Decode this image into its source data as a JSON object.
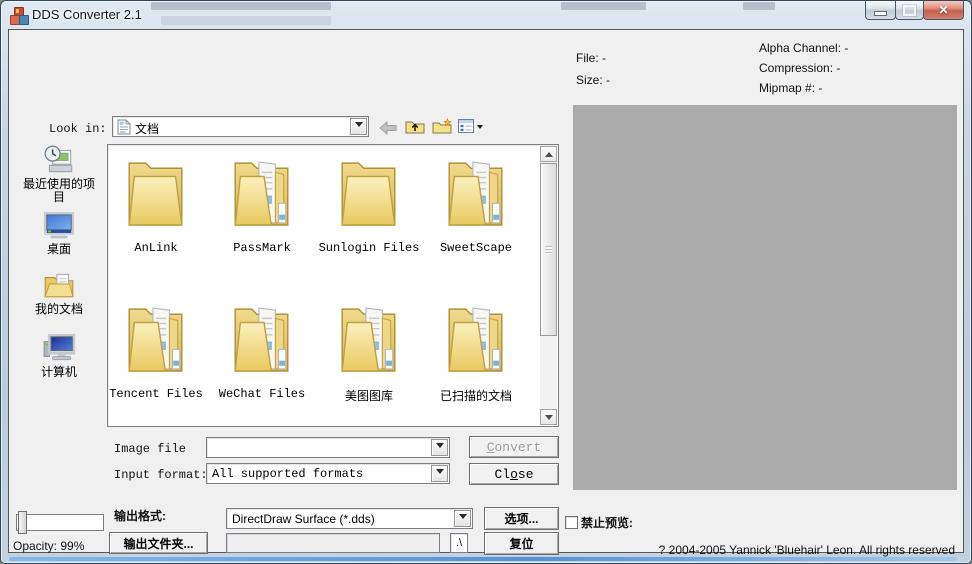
{
  "window": {
    "title": "DDS Converter 2.1"
  },
  "icons": {
    "close_glyph": "✕",
    "dropdown_glyph": "▼",
    "current_dir_glyph": ".\\"
  },
  "colors": {
    "preview_bg": "#ABABAB",
    "folder_yellow": "#EFD783",
    "close_button_red": "#C4604F",
    "titlebar_glass": "#C9D6E3",
    "client_bg": "#F0F0F0"
  },
  "info_panel": {
    "file_label": "File: -",
    "size_label": "Size: -",
    "alpha_label": "Alpha Channel: -",
    "compression_label": "Compression: -",
    "mipmap_label": "Mipmap #: -"
  },
  "file_dialog": {
    "look_in_label": "Look in:",
    "look_in_value": "文档",
    "places": [
      {
        "label": "最近使用的项目"
      },
      {
        "label": "桌面"
      },
      {
        "label": "我的文档"
      },
      {
        "label": "计算机"
      }
    ],
    "folders": [
      {
        "name": "AnLink",
        "icon": "#folder-empty"
      },
      {
        "name": "PassMark",
        "icon": "#folder-full"
      },
      {
        "name": "Sunlogin Files",
        "icon": "#folder-empty"
      },
      {
        "name": "SweetScape",
        "icon": "#folder-full"
      },
      {
        "name": "Tencent Files",
        "icon": "#folder-full"
      },
      {
        "name": "WeChat Files",
        "icon": "#folder-full"
      },
      {
        "name": "美图图库",
        "icon": "#folder-full"
      },
      {
        "name": "已扫描的文档",
        "icon": "#folder-full"
      }
    ]
  },
  "form": {
    "image_file_label": "Image file",
    "image_file_value": "",
    "input_format_label": "Input format:",
    "input_format_value": "All supported formats",
    "convert_u": "C",
    "convert_rest": "onvert",
    "close_pre": "Cl",
    "close_u": "o",
    "close_rest": "se",
    "output_format_label": "输出格式:",
    "output_format_value": "DirectDraw Surface (*.dds)",
    "options_label": "选项...",
    "output_folder_label": "输出文件夹...",
    "output_folder_value": "",
    "current_dir_label": ".\\",
    "reset_label": "复位"
  },
  "footer": {
    "disable_preview_label": "禁止预览:",
    "copyright": "? 2004-2005 Yannick 'Bluehair' Leon. All rights reserved"
  },
  "status": {
    "opacity_label": "Opacity: 99%"
  }
}
